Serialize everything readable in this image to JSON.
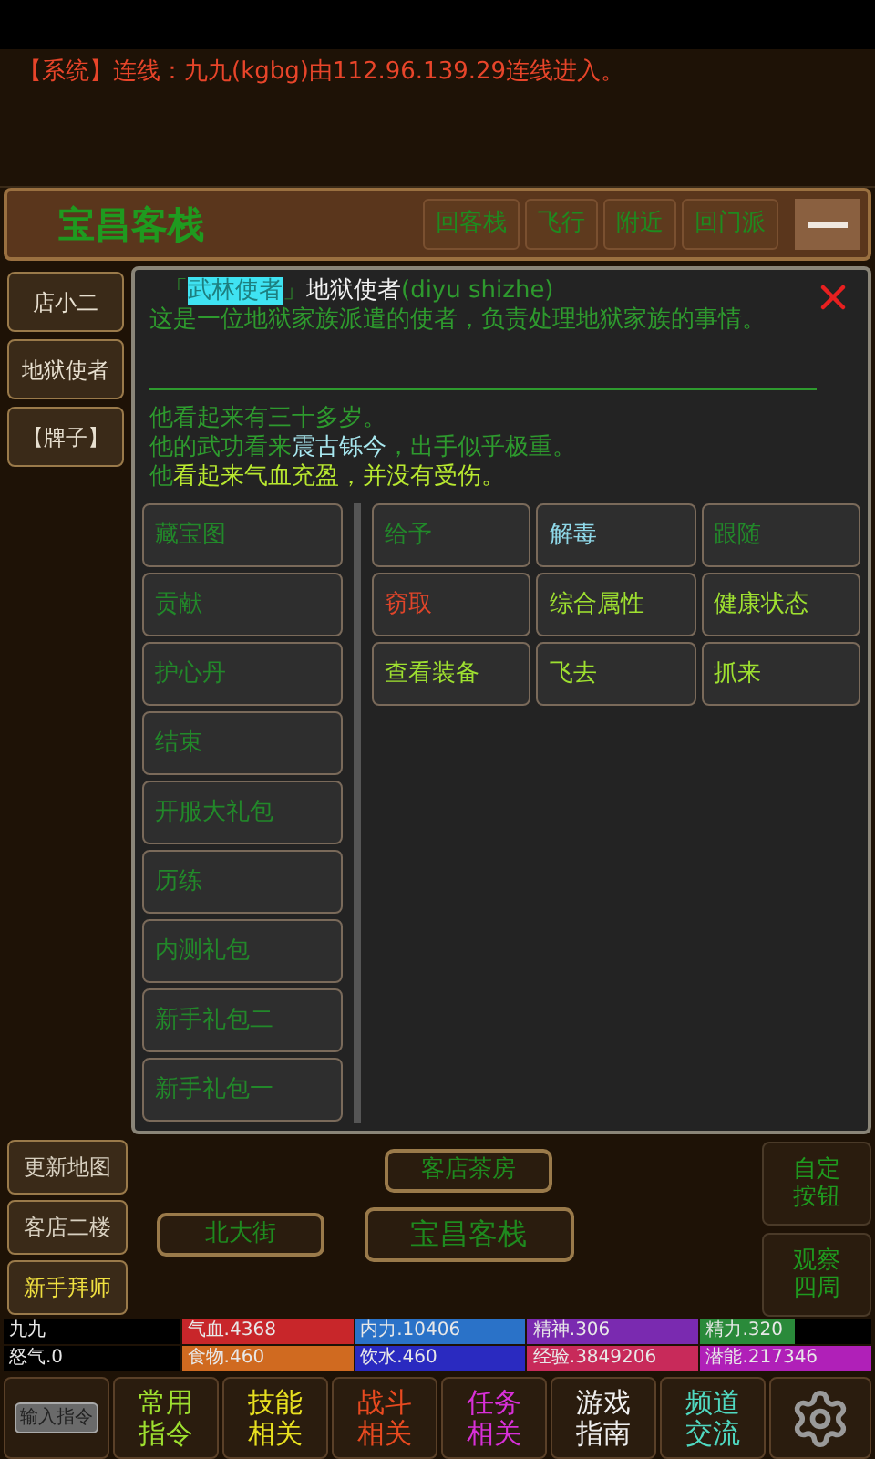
{
  "message_log": [
    "【系统】连线：九九(kgbg)由112.96.139.29连线进入。"
  ],
  "location": {
    "title": "宝昌客栈",
    "buttons": [
      "回客栈",
      "飞行",
      "附近",
      "回门派"
    ]
  },
  "npcs": [
    "店小二",
    "地狱使者",
    "【牌子】"
  ],
  "dialog": {
    "title": [
      {
        "text": "「",
        "kind": "plain"
      },
      {
        "text": "武林使者",
        "kind": "highlight"
      },
      {
        "text": "」",
        "kind": "plain"
      },
      {
        "text": "地狱使者",
        "kind": "name"
      },
      {
        "text": "(diyu shizhe)",
        "kind": "plain"
      }
    ],
    "description": "这是一位地狱家族派遣的使者，负责处理地狱家族的事情。",
    "lines": [
      [
        {
          "text": "他看起来有三十多岁。",
          "kind": "plain"
        }
      ],
      [
        {
          "text": "他的武功看来",
          "kind": "plain"
        },
        {
          "text": "震古铄今",
          "kind": "skill"
        },
        {
          "text": "，出手似乎极重。",
          "kind": "plain"
        }
      ],
      [
        {
          "text": "他",
          "kind": "plain"
        },
        {
          "text": "看起来气血充盈，并没有受伤。",
          "kind": "health"
        }
      ]
    ],
    "items": [
      {
        "label": "藏宝图",
        "color": "#22882a"
      },
      {
        "label": "贡献",
        "color": "#22882a"
      },
      {
        "label": "护心丹",
        "color": "#22882a"
      },
      {
        "label": "结束",
        "color": "#22882a"
      },
      {
        "label": "开服大礼包",
        "color": "#22882a"
      },
      {
        "label": "历练",
        "color": "#22882a"
      },
      {
        "label": "内测礼包",
        "color": "#22882a"
      },
      {
        "label": "新手礼包二",
        "color": "#22882a"
      },
      {
        "label": "新手礼包一",
        "color": "#22882a"
      }
    ],
    "actions": [
      {
        "label": "给予",
        "color": "#22882a"
      },
      {
        "label": "解毒",
        "color": "#8fd8e8"
      },
      {
        "label": "跟随",
        "color": "#22882a"
      },
      {
        "label": "窃取",
        "color": "#e0452a"
      },
      {
        "label": "综合属性",
        "color": "#9ee030"
      },
      {
        "label": "健康状态",
        "color": "#9ee030"
      },
      {
        "label": "查看装备",
        "color": "#9ee030"
      },
      {
        "label": "飞去",
        "color": "#9ee030"
      },
      {
        "label": "抓来",
        "color": "#9ee030"
      }
    ]
  },
  "side_buttons": [
    {
      "label": "更新地图",
      "color": "#d8d0c0"
    },
    {
      "label": "客店二楼",
      "color": "#d8d0c0"
    },
    {
      "label": "新手拜师",
      "color": "#f0e040"
    }
  ],
  "map": [
    {
      "label": "客店茶房",
      "kind": "north"
    },
    {
      "label": "北大街",
      "kind": "west"
    },
    {
      "label": "宝昌客栈",
      "kind": "here"
    }
  ],
  "right_buttons": [
    "自定按钮",
    "观察四周"
  ],
  "stats": [
    [
      {
        "label": "九九",
        "kind": "name"
      },
      {
        "label": "气血.4368",
        "color": "#c8262a",
        "level": 1
      },
      {
        "label": "内力.10406",
        "color": "#2a72c8",
        "level": 1
      },
      {
        "label": "精神.306",
        "color": "#7a2ab0",
        "level": 1
      },
      {
        "label": "精力.320",
        "color": "#2a8a3a",
        "level": 0.55
      }
    ],
    [
      {
        "label": "怒气.0",
        "kind": "name"
      },
      {
        "label": "食物.460",
        "color": "#d06a20",
        "level": 1
      },
      {
        "label": "饮水.460",
        "color": "#2a2ac0",
        "level": 1
      },
      {
        "label": "经验.3849206",
        "color": "#c82a5a",
        "level": 1
      },
      {
        "label": "潜能.217346",
        "color": "#b020b8",
        "level": 1
      }
    ]
  ],
  "toolbar": {
    "input_label": "输入指令",
    "buttons": [
      {
        "label": "常用指令",
        "color": "#9ee030"
      },
      {
        "label": "技能相关",
        "color": "#e8e020"
      },
      {
        "label": "战斗相关",
        "color": "#e84a20"
      },
      {
        "label": "任务相关",
        "color": "#d830d8"
      },
      {
        "label": "游戏指南",
        "color": "#f0f0f0"
      },
      {
        "label": "频道交流",
        "color": "#50d8c0"
      }
    ]
  }
}
